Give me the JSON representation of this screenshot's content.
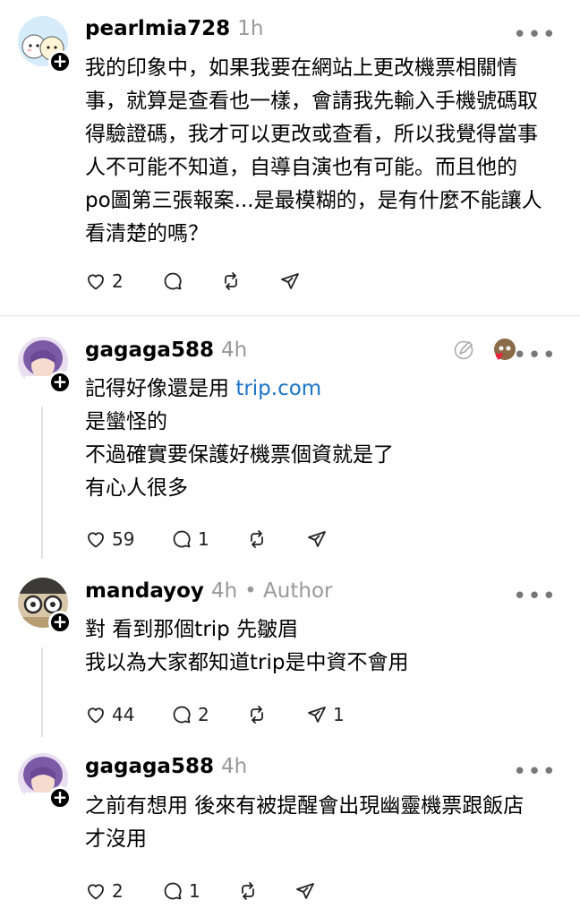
{
  "posts": [
    {
      "username": "pearlmia728",
      "time": "1h",
      "lines": [
        "我的印象中，如果我要在網站上更改機票相關情",
        "事，就算是查看也一樣，會請我先輸入手機號碼取",
        "得驗證碼，我才可以更改或查看，所以我覺得當事",
        "人不可能不知道，自導自演也有可能。而且他的",
        "po圖第三張報案...是最模糊的，是有什麼不能讓人",
        "看清楚的嗎？"
      ],
      "likes": "2",
      "replies": "",
      "shares": ""
    },
    {
      "username": "gagaga588",
      "time": "4h",
      "line1_prefix": "記得好像還是用 ",
      "line1_link": "trip.com",
      "lines": [
        "是蠻怪的",
        "不過確實要保護好機票個資就是了",
        "有心人很多"
      ],
      "likes": "59",
      "replies": "1",
      "shares": ""
    },
    {
      "username": "mandayoy",
      "time": "4h",
      "author_tag": "• Author",
      "lines": [
        "對 看到那個trip 先皺眉",
        "我以為大家都知道trip是中資不會用"
      ],
      "likes": "44",
      "replies": "2",
      "shares": "1"
    },
    {
      "username": "gagaga588",
      "time": "4h",
      "lines": [
        "之前有想用 後來有被提醒會出現幽靈機票跟飯店",
        "才沒用"
      ],
      "likes": "2",
      "replies": "1",
      "shares": ""
    }
  ],
  "icons": {
    "more": "more-icon",
    "like": "heart-icon",
    "reply": "comment-icon",
    "repost": "repost-icon",
    "share": "send-icon"
  },
  "colors": {
    "link": "#1d74c9",
    "muted": "#999999",
    "like_heart": "#e8233e"
  }
}
